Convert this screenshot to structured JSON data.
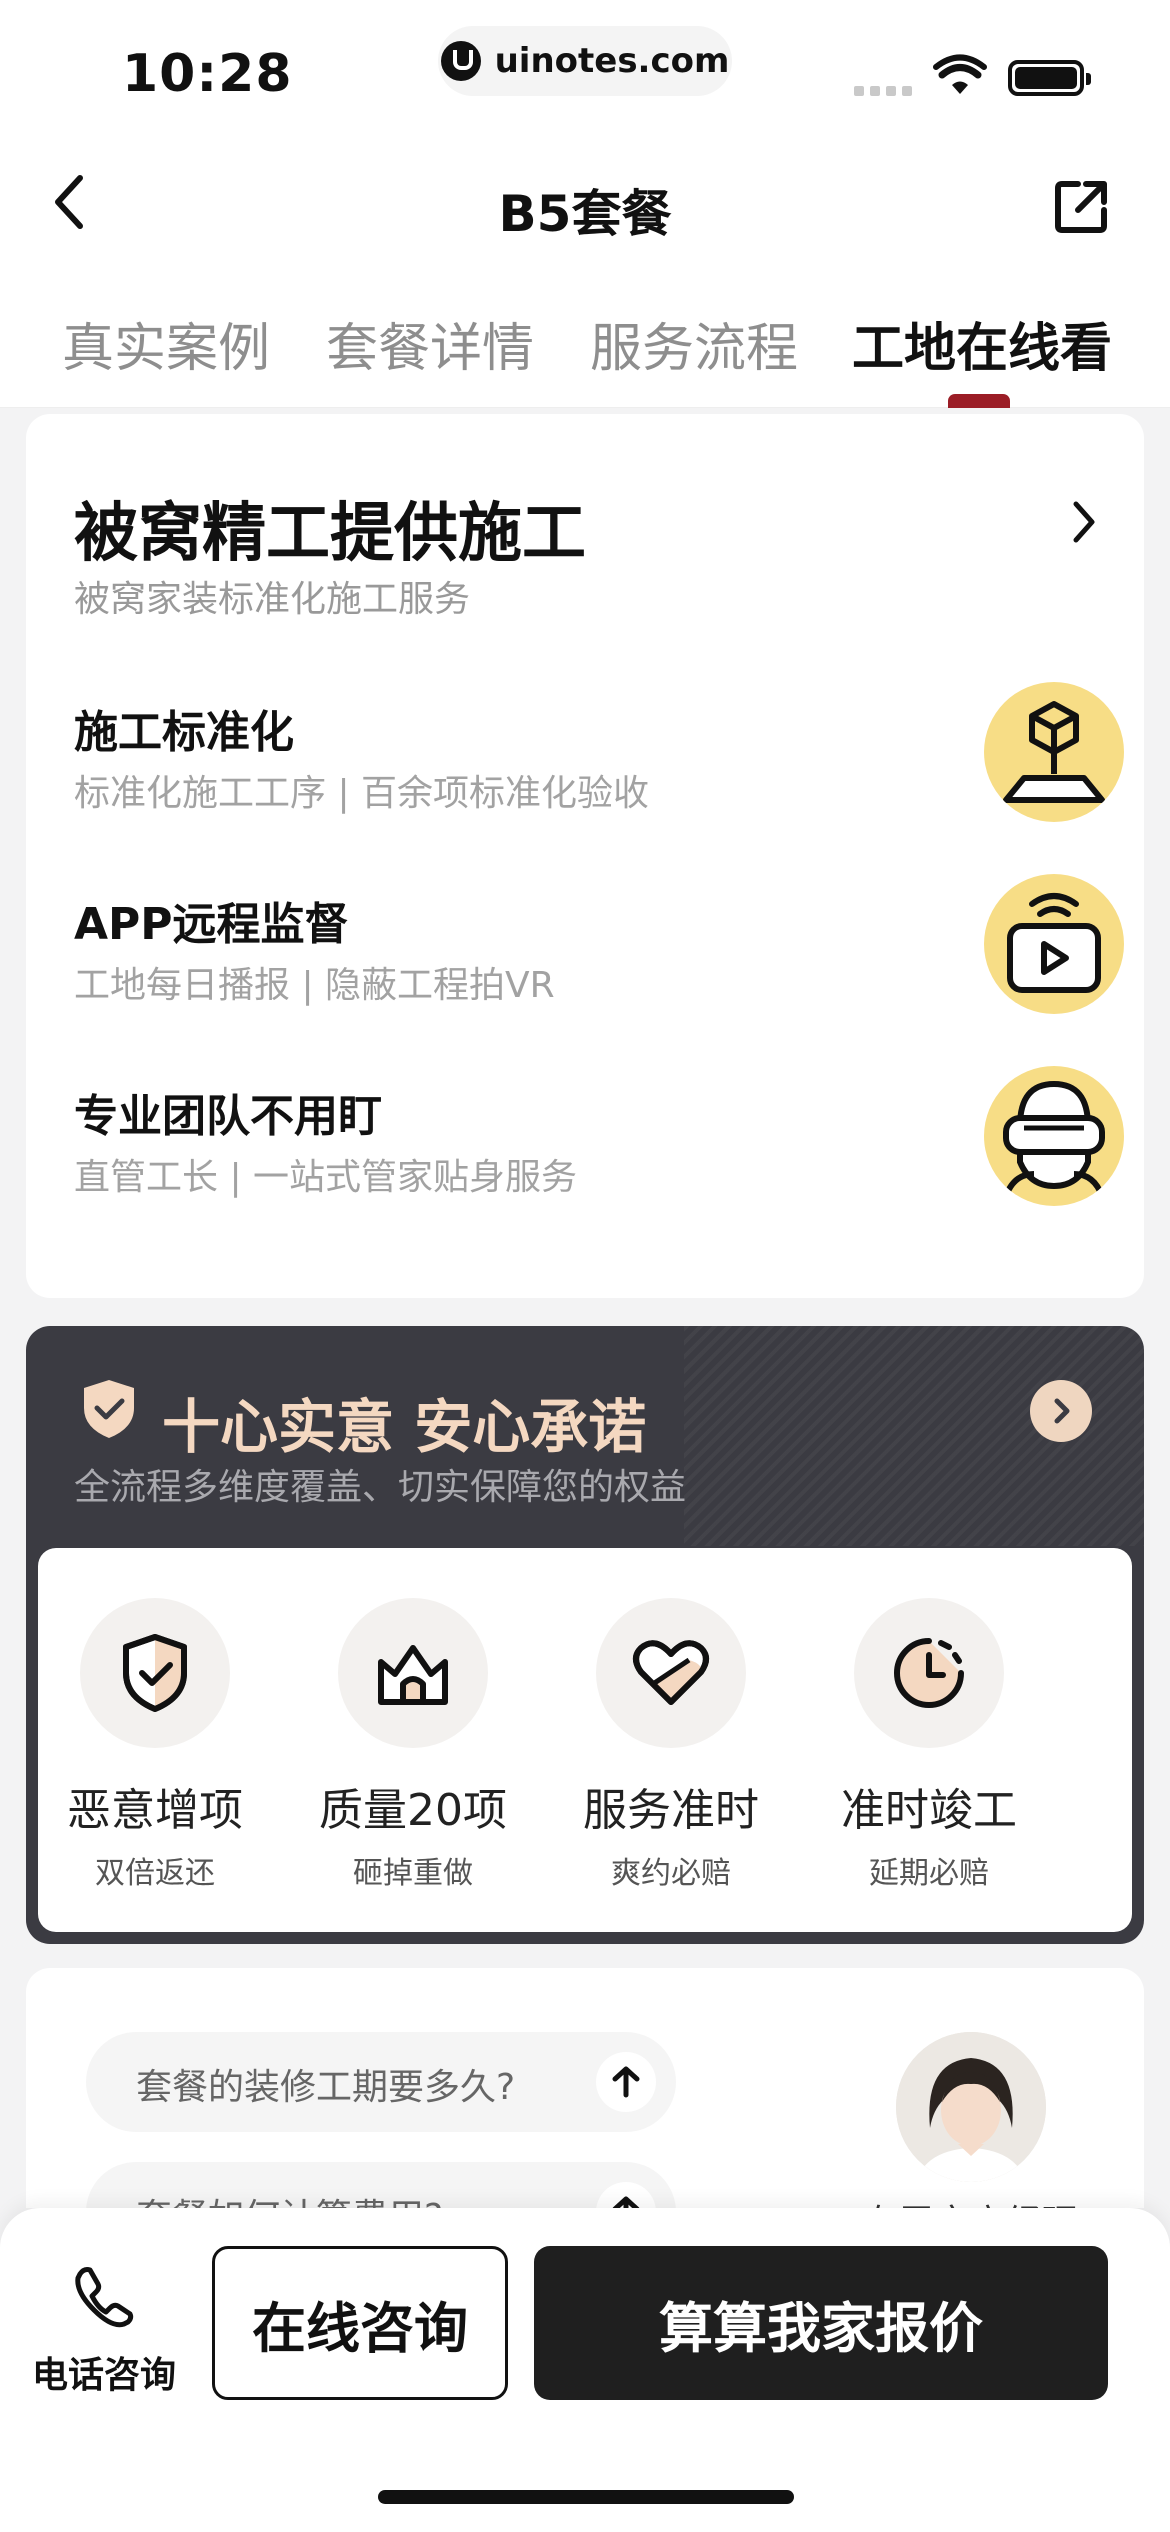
{
  "status_bar": {
    "time": "10:28",
    "url": "uinotes.com"
  },
  "nav": {
    "title": "B5套餐"
  },
  "tabs": [
    {
      "label": "真实案例",
      "active": false
    },
    {
      "label": "套餐详情",
      "active": false
    },
    {
      "label": "服务流程",
      "active": false
    },
    {
      "label": "工地在线看",
      "active": true
    }
  ],
  "construction": {
    "title": "被窝精工提供施工",
    "subtitle": "被窝家装标准化施工服务",
    "features": [
      {
        "title": "施工标准化",
        "subtitle": "标准化施工工序 | 百余项标准化验收",
        "icon": "construction-standard-icon"
      },
      {
        "title": "APP远程监督",
        "subtitle": "工地每日播报 | 隐蔽工程拍VR",
        "icon": "remote-video-icon"
      },
      {
        "title": "专业团队不用盯",
        "subtitle": "直管工长 | 一站式管家贴身服务",
        "icon": "vr-team-icon"
      }
    ],
    "icon_bg_color": "#f7dd86"
  },
  "promise": {
    "title": "十心实意 安心承诺",
    "subtitle": "全流程多维度覆盖、切实保障您的权益",
    "items": [
      {
        "name": "恶意增项",
        "desc": "双倍返还",
        "icon": "shield-check-icon"
      },
      {
        "name": "质量20项",
        "desc": "砸掉重做",
        "icon": "house-icon"
      },
      {
        "name": "服务准时",
        "desc": "爽约必赔",
        "icon": "heart-icon"
      },
      {
        "name": "准时竣工",
        "desc": "延期必赔",
        "icon": "clock-icon"
      }
    ],
    "accent_color": "#f4d8c1",
    "bg_color": "#3b3b42"
  },
  "faq": {
    "questions": [
      "套餐的装修工期要多久?",
      "套餐如何计算费用?"
    ],
    "manager_label": "专属客户经理"
  },
  "bottom_bar": {
    "phone_label": "电话咨询",
    "consult_label": "在线咨询",
    "quote_label": "算算我家报价"
  }
}
